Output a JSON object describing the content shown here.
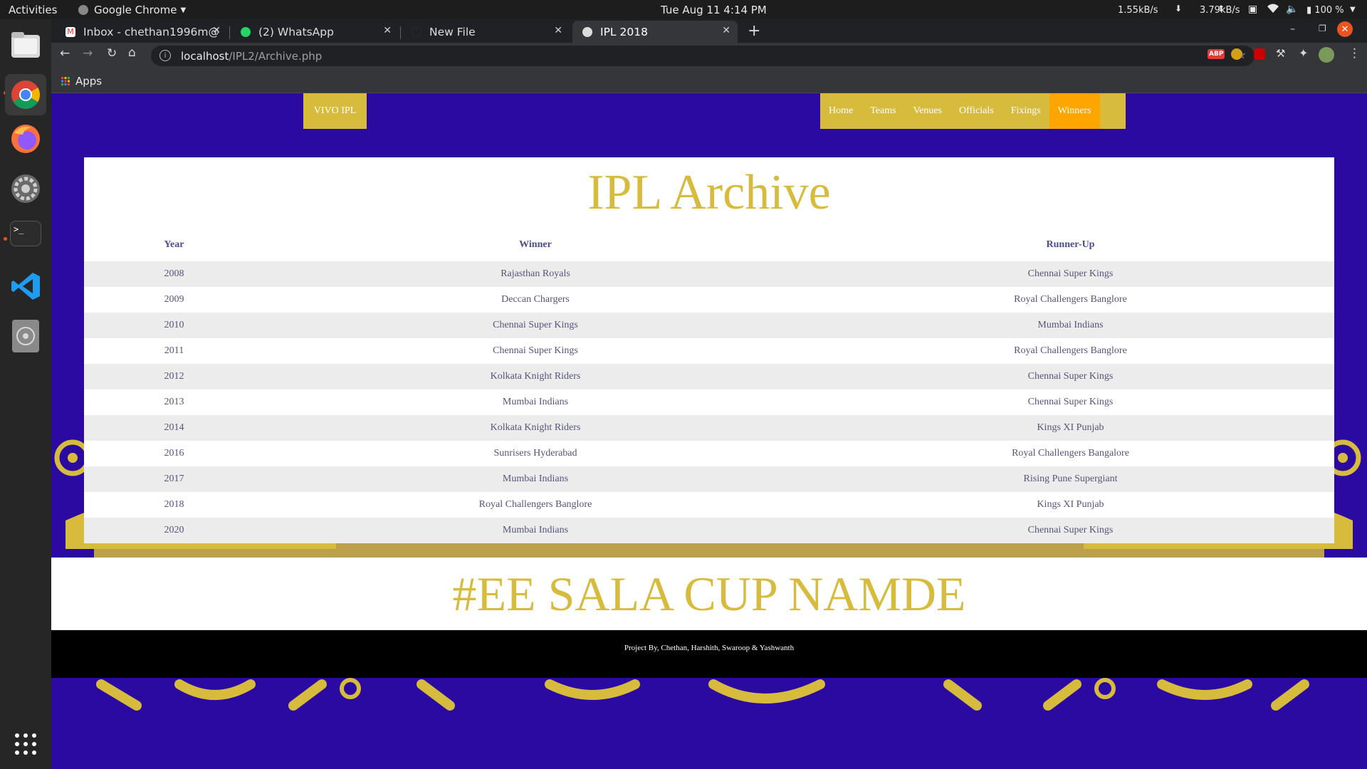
{
  "system": {
    "activities": "Activities",
    "app": "Google Chrome",
    "datetime": "Tue Aug 11   4:14 PM",
    "net_down": "1.55kB/s",
    "net_up": "3.79kB/s",
    "battery": "100 %"
  },
  "browser": {
    "tabs": [
      {
        "title": "Inbox - chethan1996m@",
        "icon": "gmail-icon"
      },
      {
        "title": "(2) WhatsApp",
        "icon": "whatsapp-icon"
      },
      {
        "title": "New File",
        "icon": "github-icon"
      },
      {
        "title": "IPL 2018",
        "icon": "globe-icon"
      }
    ],
    "url_host": "localhost",
    "url_path": "/IPL2/Archive.php",
    "bookmarks_apps": "Apps",
    "ext_abp": "ABP"
  },
  "page": {
    "brand": "VIVO IPL",
    "nav": [
      "Home",
      "Teams",
      "Venues",
      "Officials",
      "Fixings",
      "Winners"
    ],
    "active_nav": "Winners",
    "title": "IPL Archive",
    "columns": [
      "Year",
      "Winner",
      "Runner-Up"
    ],
    "rows": [
      [
        "2008",
        "Rajasthan Royals",
        "Chennai Super Kings"
      ],
      [
        "2009",
        "Deccan Chargers",
        "Royal Challengers Banglore"
      ],
      [
        "2010",
        "Chennai Super Kings",
        "Mumbai Indians"
      ],
      [
        "2011",
        "Chennai Super Kings",
        "Royal Challengers Banglore"
      ],
      [
        "2012",
        "Kolkata Knight Riders",
        "Chennai Super Kings"
      ],
      [
        "2013",
        "Mumbai Indians",
        "Chennai Super Kings"
      ],
      [
        "2014",
        "Kolkata Knight Riders",
        "Kings XI Punjab"
      ],
      [
        "2016",
        "Sunrisers Hyderabad",
        "Royal Challengers Bangalore"
      ],
      [
        "2017",
        "Mumbai Indians",
        "Rising Pune Supergiant"
      ],
      [
        "2018",
        "Royal Challengers Banglore",
        "Kings XI Punjab"
      ],
      [
        "2020",
        "Mumbai Indians",
        "Chennai Super Kings"
      ]
    ],
    "slogan": "#EE SALA CUP NAMDE",
    "footer": "Project By, Chethan, Harshith, Swaroop & Yashwanth"
  },
  "colors": {
    "purple": "#2a0aa0",
    "gold": "#d7bb3d",
    "orange": "#ffa500"
  }
}
